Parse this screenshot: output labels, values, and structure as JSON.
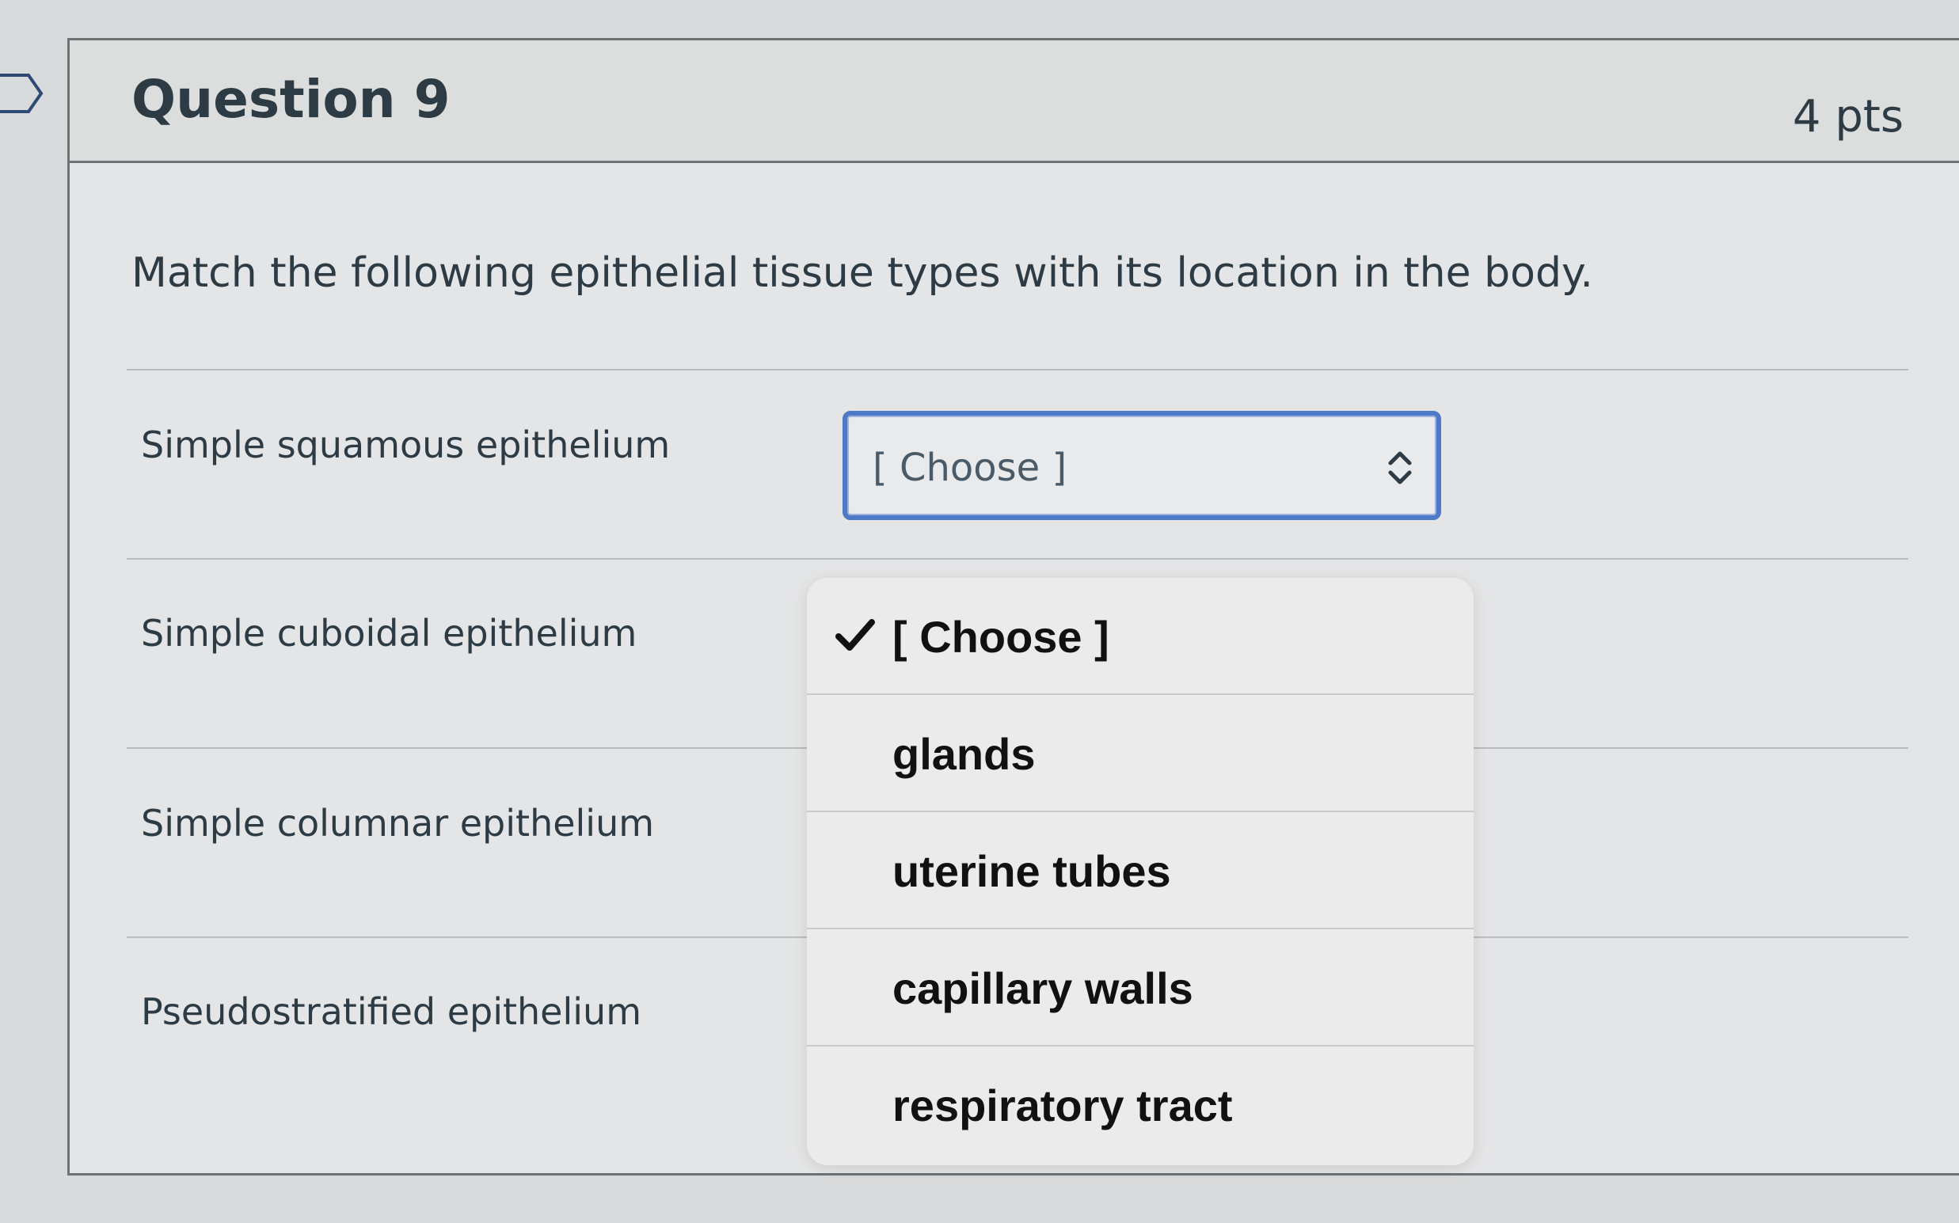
{
  "question": {
    "title": "Question 9",
    "points": "4 pts",
    "prompt": "Match the following epithelial tissue types with its location in the body."
  },
  "rows": [
    {
      "label": "Simple squamous epithelium"
    },
    {
      "label": "Simple cuboidal epithelium"
    },
    {
      "label": "Simple columnar epithelium"
    },
    {
      "label": "Pseudostratified epithelium"
    }
  ],
  "select": {
    "value": "[ Choose ]",
    "icon": "up-down-chevron-icon"
  },
  "dropdown": {
    "options": [
      {
        "label": "[ Choose ]",
        "selected": true
      },
      {
        "label": "glands",
        "selected": false
      },
      {
        "label": "uterine tubes",
        "selected": false
      },
      {
        "label": "capillary walls",
        "selected": false
      },
      {
        "label": "respiratory tract",
        "selected": false
      }
    ],
    "check_icon": "checkmark-icon"
  },
  "colors": {
    "focus_border": "#4d79c7",
    "text": "#2d3b45"
  }
}
